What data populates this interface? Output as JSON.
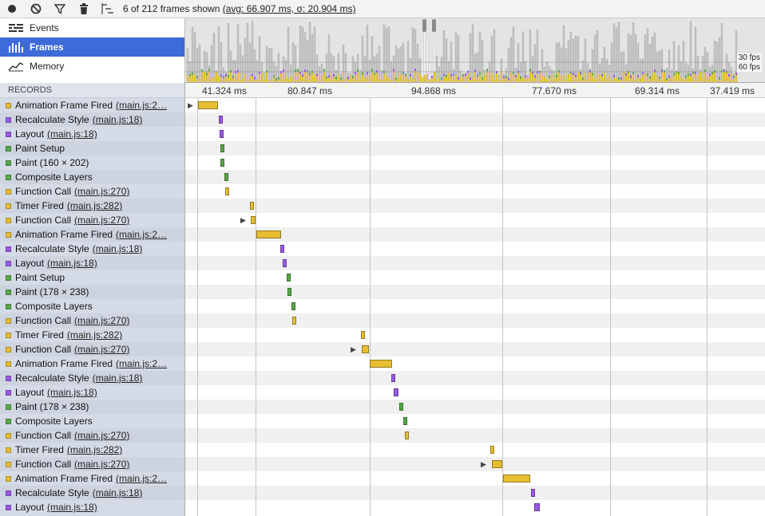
{
  "toolbar": {
    "status_prefix": "6 of 212 frames shown ",
    "status_avg": "(avg: 66.907 ms, σ: 20.904 ms)",
    "icons": [
      "record-icon",
      "clear-icon",
      "filter-icon",
      "trash-icon",
      "glue-records-icon"
    ]
  },
  "modes": [
    {
      "label": "Events",
      "icon": "events-icon",
      "selected": false
    },
    {
      "label": "Frames",
      "icon": "frames-icon",
      "selected": true
    },
    {
      "label": "Memory",
      "icon": "memory-icon",
      "selected": false
    }
  ],
  "overview": {
    "fps_30": "30 fps",
    "fps_60": "60 fps"
  },
  "records_header": "RECORDS",
  "timeline_ticks": [
    "41.324 ms",
    "80.847 ms",
    "94.868 ms",
    "77.670 ms",
    "69.314 ms",
    "37.419 ms"
  ],
  "colors": {
    "scripting": "#e6be30",
    "rendering": "#9b59e6",
    "painting": "#5aa84a",
    "selected": "#3d6bd8"
  },
  "records": [
    {
      "name": "Animation Frame Fired",
      "loc": "(main.js:2…",
      "cat": "scripting"
    },
    {
      "name": "Recalculate Style",
      "loc": "(main.js:18)",
      "cat": "rendering"
    },
    {
      "name": "Layout",
      "loc": "(main.js:18)",
      "cat": "rendering"
    },
    {
      "name": "Paint Setup",
      "loc": "",
      "cat": "painting"
    },
    {
      "name": "Paint (160 × 202)",
      "loc": "",
      "cat": "painting"
    },
    {
      "name": "Composite Layers",
      "loc": "",
      "cat": "painting"
    },
    {
      "name": "Function Call",
      "loc": "(main.js:270)",
      "cat": "scripting"
    },
    {
      "name": "Timer Fired",
      "loc": "(main.js:282)",
      "cat": "scripting"
    },
    {
      "name": "Function Call",
      "loc": "(main.js:270)",
      "cat": "scripting"
    },
    {
      "name": "Animation Frame Fired",
      "loc": "(main.js:2…",
      "cat": "scripting"
    },
    {
      "name": "Recalculate Style",
      "loc": "(main.js:18)",
      "cat": "rendering"
    },
    {
      "name": "Layout",
      "loc": "(main.js:18)",
      "cat": "rendering"
    },
    {
      "name": "Paint Setup",
      "loc": "",
      "cat": "painting"
    },
    {
      "name": "Paint (178 × 238)",
      "loc": "",
      "cat": "painting"
    },
    {
      "name": "Composite Layers",
      "loc": "",
      "cat": "painting"
    },
    {
      "name": "Function Call",
      "loc": "(main.js:270)",
      "cat": "scripting"
    },
    {
      "name": "Timer Fired",
      "loc": "(main.js:282)",
      "cat": "scripting"
    },
    {
      "name": "Function Call",
      "loc": "(main.js:270)",
      "cat": "scripting"
    },
    {
      "name": "Animation Frame Fired",
      "loc": "(main.js:2…",
      "cat": "scripting"
    },
    {
      "name": "Recalculate Style",
      "loc": "(main.js:18)",
      "cat": "rendering"
    },
    {
      "name": "Layout",
      "loc": "(main.js:18)",
      "cat": "rendering"
    },
    {
      "name": "Paint (178 × 238)",
      "loc": "",
      "cat": "painting"
    },
    {
      "name": "Composite Layers",
      "loc": "",
      "cat": "painting"
    },
    {
      "name": "Function Call",
      "loc": "(main.js:270)",
      "cat": "scripting"
    },
    {
      "name": "Timer Fired",
      "loc": "(main.js:282)",
      "cat": "scripting"
    },
    {
      "name": "Function Call",
      "loc": "(main.js:270)",
      "cat": "scripting"
    },
    {
      "name": "Animation Frame Fired",
      "loc": "(main.js:2…",
      "cat": "scripting"
    },
    {
      "name": "Recalculate Style",
      "loc": "(main.js:18)",
      "cat": "rendering"
    },
    {
      "name": "Layout",
      "loc": "(main.js:18)",
      "cat": "rendering"
    }
  ]
}
